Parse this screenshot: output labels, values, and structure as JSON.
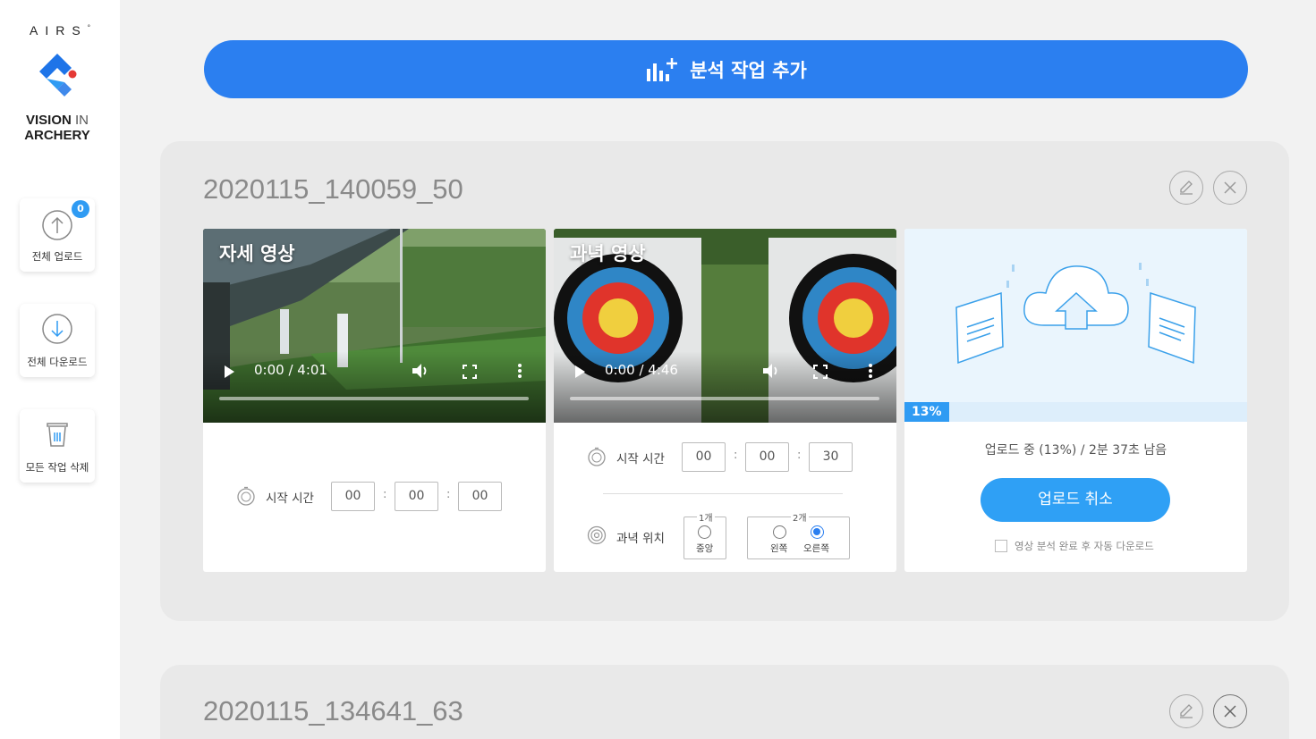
{
  "sidebar": {
    "brand_top": "AIRS",
    "brand_mark": "°",
    "brand_line1_bold": "VISION",
    "brand_line1_thin": "IN",
    "brand_line2": "ARCHERY",
    "upload_all": {
      "label": "전체 업로드",
      "badge": "0"
    },
    "download_all": {
      "label": "전체 다운로드"
    },
    "delete_all": {
      "label": "모든 작업 삭제"
    }
  },
  "add_task_button": "분석 작업 추가",
  "jobs": [
    {
      "title": "2020115_140059_50",
      "pose_video": {
        "label": "자세 영상",
        "time": "0:00 / 4:01",
        "start_time_label": "시작 시간",
        "start_time": [
          "00",
          "00",
          "00"
        ]
      },
      "target_video": {
        "label": "과녁 영상",
        "time": "0:00 / 4:46",
        "start_time_label": "시작 시간",
        "start_time": [
          "00",
          "00",
          "30"
        ],
        "target_position_label": "과녁 위치",
        "group1_title": "1개",
        "group1_options": [
          "중앙"
        ],
        "group2_title": "2개",
        "group2_options": [
          "왼쪽",
          "오른쪽"
        ],
        "selected": "오른쪽"
      },
      "upload": {
        "progress_percent": 13,
        "progress_label": "13%",
        "status": "업로드 중 (13%) / 2분 37초 남음",
        "cancel_label": "업로드 취소",
        "auto_download_label": "영상 분석 완료 후 자동 다운로드",
        "auto_download_checked": false
      }
    },
    {
      "title": "2020115_134641_63"
    }
  ],
  "colors": {
    "primary": "#2b7ff0",
    "accent": "#2f9bf3",
    "background": "#f2f2f2"
  }
}
